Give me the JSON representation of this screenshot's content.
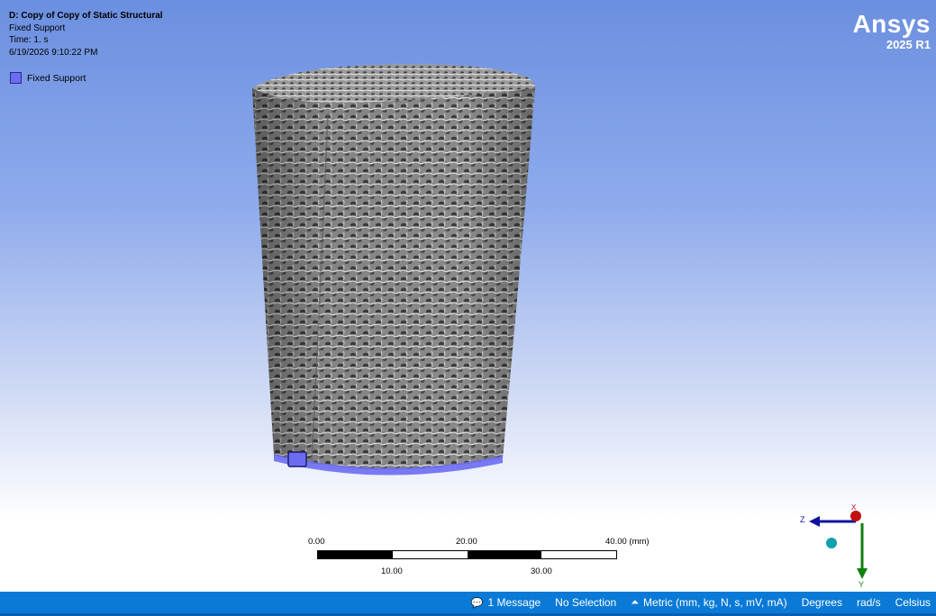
{
  "viewport": {
    "analysis_title": "D: Copy of Copy of Static Structural",
    "object_name": "Fixed Support",
    "time_label": "Time: 1. s",
    "timestamp": "6/19/2026 9:10:22 PM",
    "legend_label": "Fixed Support",
    "legend_color": "#6c6cf2",
    "brand_name": "Ansys",
    "brand_version": "2025 R1"
  },
  "scale": {
    "top_labels": [
      "0.00",
      "20.00",
      "40.00 (mm)"
    ],
    "bottom_labels": [
      "10.00",
      "30.00"
    ]
  },
  "triad": {
    "x": "X",
    "y": "Y",
    "z": "Z"
  },
  "status": {
    "message": "1 Message",
    "selection": "No Selection",
    "units": "Metric (mm, kg, N, s, mV, mA)",
    "angle": "Degrees",
    "rate": "rad/s",
    "temperature": "Celsius"
  },
  "colors": {
    "status_bar": "#0a7ad6",
    "support_highlight": "#6c6cf2"
  }
}
